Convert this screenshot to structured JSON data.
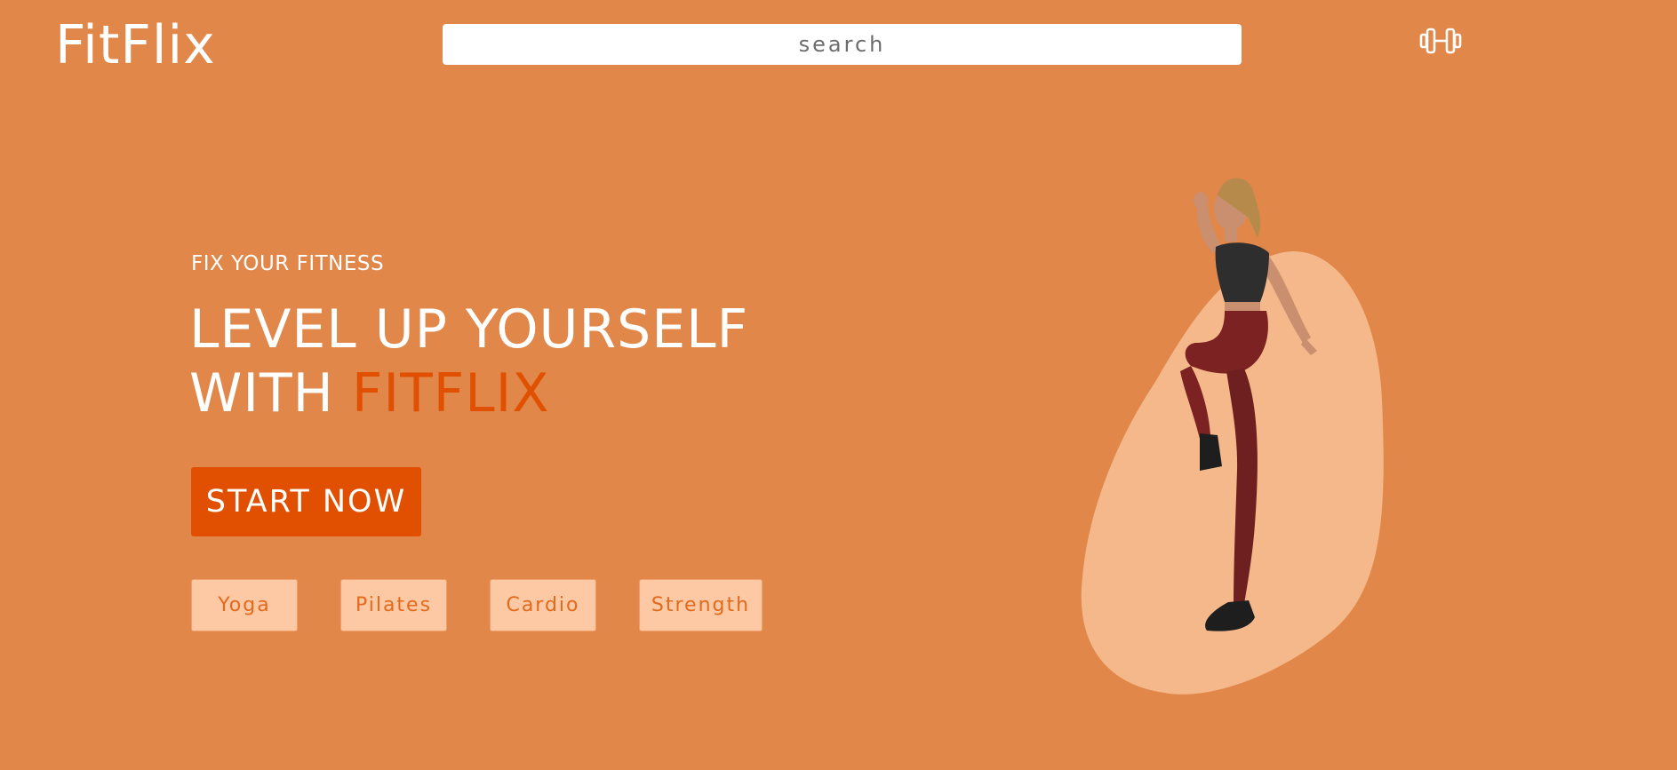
{
  "header": {
    "logo": "FitFlix",
    "search_placeholder": "search",
    "gym_icon": "dumbbell-icon"
  },
  "hero": {
    "eyebrow": "FIX YOUR FITNESS",
    "headline_line1": "LEVEL UP YOURSELF",
    "headline_line2_prefix": "WITH ",
    "headline_accent": "FITFLIX",
    "cta_label": "START NOW",
    "categories": [
      "Yoga",
      "Pilates",
      "Cardio",
      "Strength"
    ]
  },
  "colors": {
    "background": "#e18749",
    "accent": "#e15000",
    "chip_background": "#fdc9a5",
    "chip_text": "#e26a1c",
    "blob": "#f5b88b"
  }
}
